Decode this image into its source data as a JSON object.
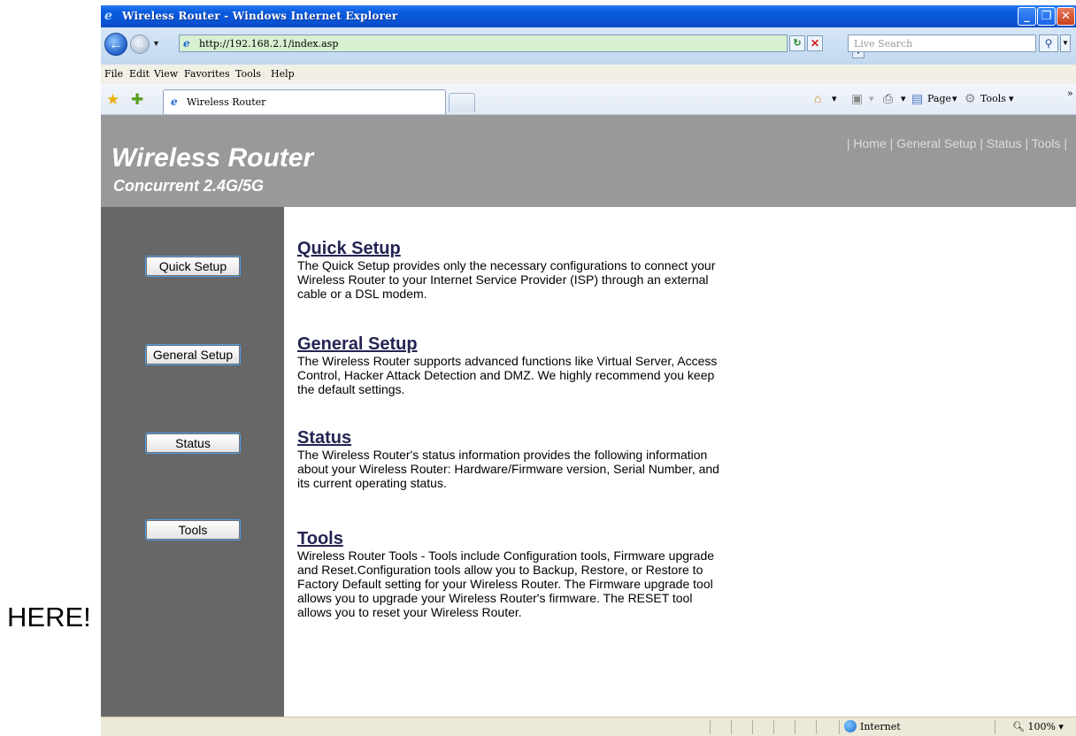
{
  "annotation": {
    "text": "HERE!"
  },
  "window": {
    "title": "Wireless Router - Windows Internet Explorer"
  },
  "addressbar": {
    "url": "http://192.168.2.1/index.asp",
    "search_placeholder": "Live Search"
  },
  "menubar": {
    "items": [
      "File",
      "Edit",
      "View",
      "Favorites",
      "Tools",
      "Help"
    ]
  },
  "tab": {
    "label": "Wireless Router"
  },
  "command_bar": {
    "page_label": "Page",
    "tools_label": "Tools"
  },
  "header": {
    "title": "Wireless Router",
    "subtitle": "Concurrent 2.4G/5G",
    "nav": [
      "Home",
      "General Setup",
      "Status",
      "Tools"
    ]
  },
  "sidebar": {
    "buttons": [
      "Quick Setup",
      "General Setup",
      "Status",
      "Tools"
    ]
  },
  "sections": [
    {
      "title": "Quick Setup",
      "desc": "The Quick Setup provides only the necessary configurations to connect your Wireless Router to your Internet Service Provider (ISP) through an external cable or a DSL modem."
    },
    {
      "title": "General Setup",
      "desc": "The Wireless Router supports advanced functions like Virtual Server, Access Control, Hacker Attack Detection and DMZ. We highly recommend you keep the default settings."
    },
    {
      "title": "Status",
      "desc": "The Wireless Router's status information provides the following information about your Wireless Router: Hardware/Firmware version, Serial Number, and its current operating status."
    },
    {
      "title": "Tools",
      "desc": "Wireless Router Tools - Tools include Configuration tools, Firmware upgrade and Reset.Configuration tools allow you to Backup, Restore, or Restore to Factory Default setting for your Wireless Router. The Firmware upgrade tool allows you to upgrade your Wireless Router's firmware. The RESET tool allows you to reset your Wireless Router."
    }
  ],
  "statusbar": {
    "zone": "Internet",
    "zoom": "100%"
  }
}
